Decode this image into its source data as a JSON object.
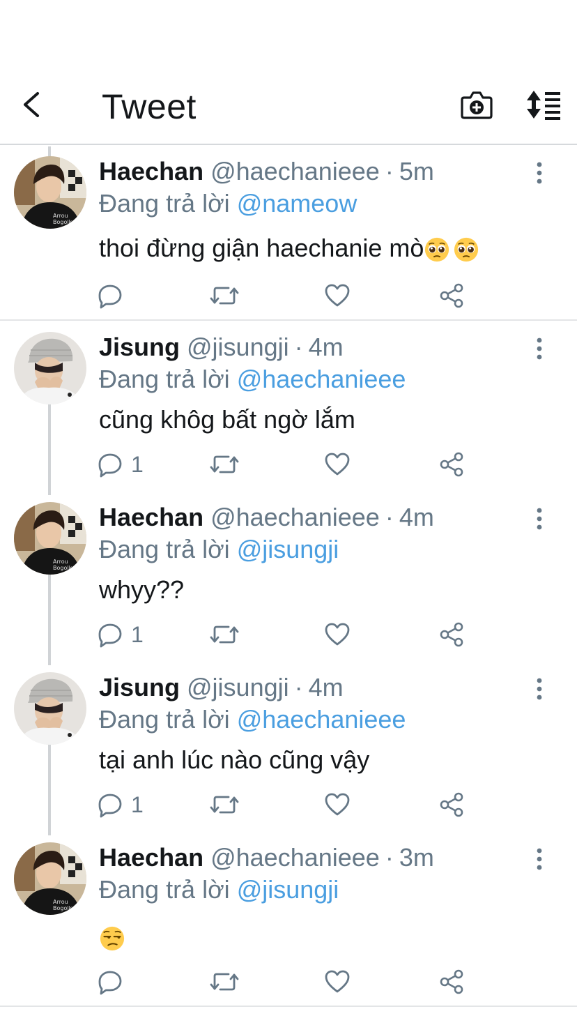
{
  "header": {
    "title": "Tweet",
    "back_icon": "chevron-left-icon",
    "camera_icon": "camera-plus-icon",
    "sort_icon": "sort-list-icon"
  },
  "colors": {
    "text": "#14171a",
    "secondary": "#657786",
    "link": "#4a9ee0",
    "divider": "#e3e5e7"
  },
  "tweets": [
    {
      "name": "Haechan",
      "handle": "@haechanieee",
      "dot": "·",
      "time": "5m",
      "reply_prefix": "Đang trả lời",
      "reply_to": "@nameow",
      "text": "thoi đừng giận haechanie mò",
      "emoji": "pleading-face x2",
      "reply_count": ""
    },
    {
      "name": "Jisung",
      "handle": "@jisungji",
      "dot": "·",
      "time": "4m",
      "reply_prefix": "Đang trả lời",
      "reply_to": "@haechanieee",
      "text": "cũng khôg bất ngờ lắm",
      "reply_count": "1"
    },
    {
      "name": "Haechan",
      "handle": "@haechanieee",
      "dot": "·",
      "time": "4m",
      "reply_prefix": "Đang trả lời",
      "reply_to": "@jisungji",
      "text": "whyy??",
      "reply_count": "1"
    },
    {
      "name": "Jisung",
      "handle": "@jisungji",
      "dot": "·",
      "time": "4m",
      "reply_prefix": "Đang trả lời",
      "reply_to": "@haechanieee",
      "text": "tại anh lúc nào cũng vậy",
      "reply_count": "1"
    },
    {
      "name": "Haechan",
      "handle": "@haechanieee",
      "dot": "·",
      "time": "3m",
      "reply_prefix": "Đang trả lời",
      "reply_to": "@jisungji",
      "text": "",
      "emoji": "unamused-face",
      "reply_count": ""
    }
  ]
}
